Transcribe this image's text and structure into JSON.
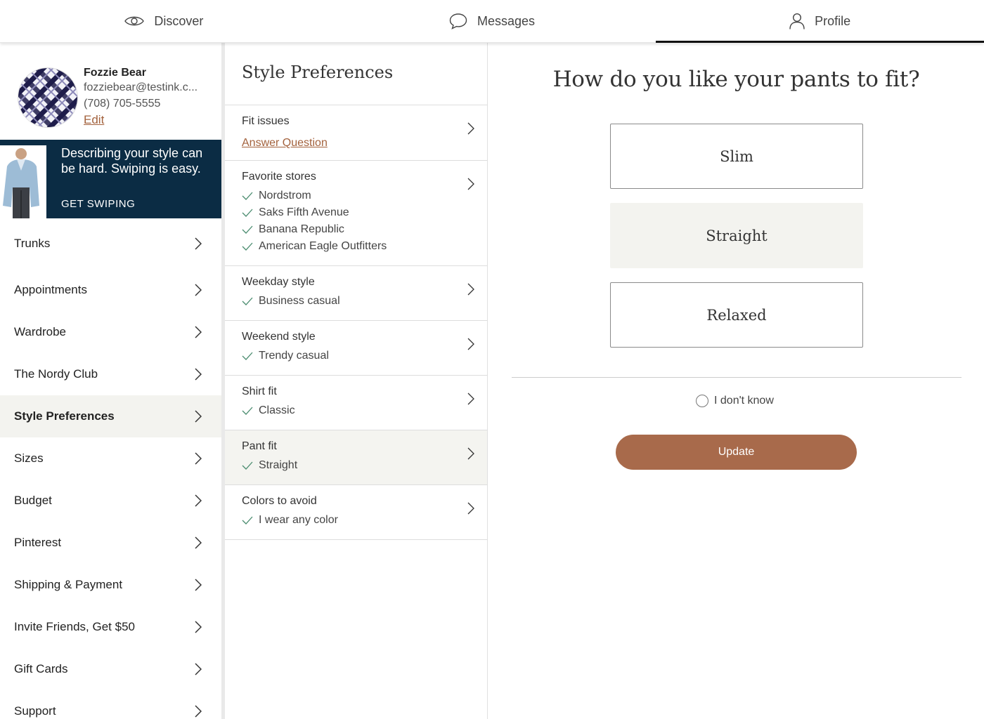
{
  "nav": {
    "tabs": [
      {
        "label": "Discover",
        "icon": "eye-icon"
      },
      {
        "label": "Messages",
        "icon": "chat-bubble-icon"
      },
      {
        "label": "Profile",
        "icon": "person-icon",
        "active": true
      }
    ]
  },
  "profile": {
    "name": "Fozzie Bear",
    "email": "fozziebear@testink.c...",
    "phone": "(708) 705-5555",
    "edit_label": "Edit"
  },
  "promo": {
    "text": "Describing your style can be hard. Swiping is easy.",
    "cta": "GET SWIPING"
  },
  "menu": {
    "items": [
      {
        "label": "Trunks"
      },
      {
        "label": "Appointments"
      },
      {
        "label": "Wardrobe"
      },
      {
        "label": "The Nordy Club"
      },
      {
        "label": "Style Preferences",
        "active": true
      },
      {
        "label": "Sizes"
      },
      {
        "label": "Budget"
      },
      {
        "label": "Pinterest"
      },
      {
        "label": "Shipping & Payment"
      },
      {
        "label": "Invite Friends, Get $50"
      },
      {
        "label": "Gift Cards"
      },
      {
        "label": "Support"
      }
    ]
  },
  "preferences": {
    "title": "Style Preferences",
    "fit_issues": {
      "title": "Fit issues",
      "link": "Answer Question"
    },
    "favorite_stores": {
      "title": "Favorite stores",
      "values": [
        "Nordstrom",
        "Saks Fifth Avenue",
        "Banana Republic",
        "American Eagle Outfitters"
      ]
    },
    "weekday_style": {
      "title": "Weekday style",
      "values": [
        "Business casual"
      ]
    },
    "weekend_style": {
      "title": "Weekend style",
      "values": [
        "Trendy casual"
      ]
    },
    "shirt_fit": {
      "title": "Shirt fit",
      "values": [
        "Classic"
      ]
    },
    "pant_fit": {
      "title": "Pant fit",
      "values": [
        "Straight"
      ]
    },
    "colors_to_avoid": {
      "title": "Colors to avoid",
      "values": [
        "I wear any color"
      ]
    }
  },
  "question": {
    "title": "How do you like your pants to fit?",
    "options": [
      "Slim",
      "Straight",
      "Relaxed"
    ],
    "selected": "Straight",
    "dont_know": "I don't know",
    "update_label": "Update"
  },
  "colors": {
    "accent": "#a86a4b",
    "promo_bg": "#0b2c44",
    "check": "#4a8c6f",
    "selected_bg": "#f3f3ef"
  }
}
